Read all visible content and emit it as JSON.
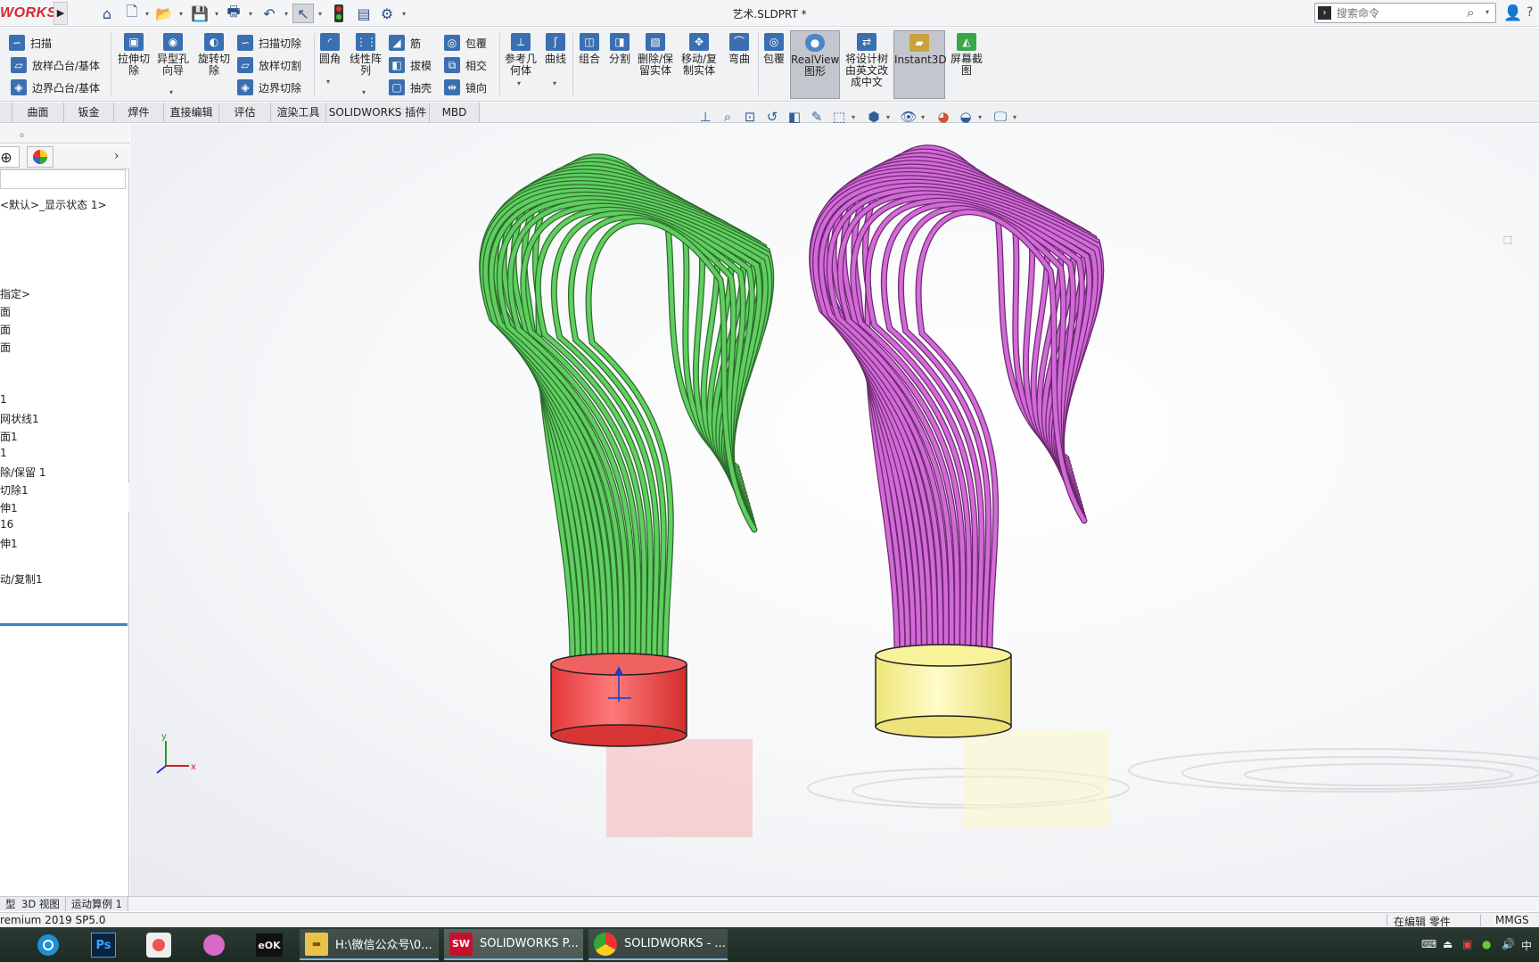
{
  "app": {
    "logo_text": "WORKS",
    "document_title": "艺术.SLDPRT *"
  },
  "search": {
    "placeholder": "搜索命令"
  },
  "ribbon": {
    "sweep": "扫描",
    "loft_boss": "放样凸台/基体",
    "boundary_boss": "边界凸台/基体",
    "extruded_cut": "拉伸切除",
    "hole_wizard": "异型孔向导",
    "revolved_cut": "旋转切除",
    "swept_cut": "扫描切除",
    "lofted_cut": "放样切割",
    "boundary_cut": "边界切除",
    "fillet": "圆角",
    "linear_pattern": "线性阵列",
    "rib": "筋",
    "draft": "拔模",
    "shell": "抽壳",
    "wrap": "包覆",
    "intersect": "相交",
    "mirror": "镜向",
    "reference_geometry": "参考几何体",
    "curves": "曲线",
    "combine": "组合",
    "split": "分割",
    "delete_keep_body": "删除/保留实体",
    "move_copy_body": "移动/复制实体",
    "flex": "弯曲",
    "wrap2": "包覆",
    "realview": "RealView图形",
    "translate_tree": "将设计树由英文改成中文",
    "instant3d": "Instant3D",
    "screenshot": "屏幕截图"
  },
  "tabs": [
    "曲面",
    "钣金",
    "焊件",
    "直接编辑",
    "评估",
    "渲染工具",
    "SOLIDWORKS 插件",
    "MBD"
  ],
  "tree": [
    "<默认>_显示状态 1>",
    "指定>",
    "面",
    "面",
    "面",
    "1",
    "网状线1",
    "面1",
    "1",
    "除/保留 1",
    "切除1",
    "伸1",
    "16",
    "伸1",
    "动/复制1"
  ],
  "view_tabs": [
    "型",
    "3D 视图",
    "运动算例 1"
  ],
  "status": {
    "version": "remium 2019 SP5.0",
    "mode": "在编辑 零件",
    "units": "MMGS"
  },
  "taskbar": {
    "explorer_btn": "H:\\微信公众号\\0...",
    "solidworks_btn": "SOLIDWORKS P...",
    "chrome_btn": "SOLIDWORKS - ..."
  },
  "triad": {
    "x_label": "x",
    "y_label": "y"
  },
  "colors": {
    "green_sculpture": "#5fcf5f",
    "pink_sculpture": "#d36ad8",
    "red_base": "#ef4a4a",
    "yellow_base": "#f7f18c",
    "accent": "#3d82c7"
  }
}
